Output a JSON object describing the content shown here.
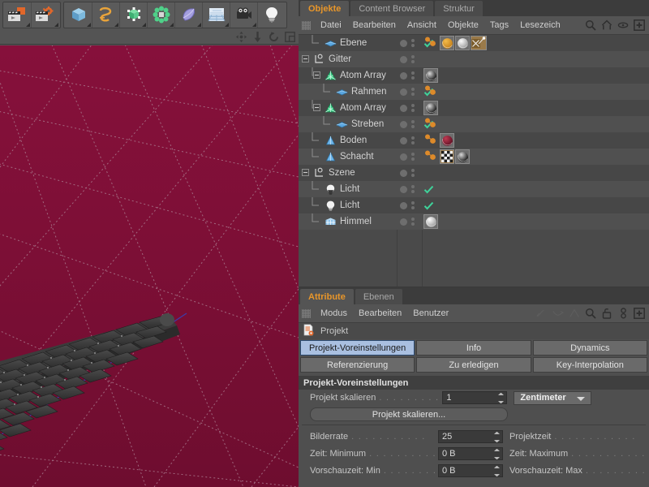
{
  "toolbar": {
    "groups": [
      {
        "name": "playback-group",
        "buttons": [
          {
            "name": "render-view-button",
            "icon": "clapper-render-icon"
          },
          {
            "name": "render-settings-button",
            "icon": "clapper-gear-icon"
          }
        ]
      },
      {
        "name": "primitives-group",
        "buttons": [
          {
            "name": "cube-button",
            "icon": "cube-icon"
          },
          {
            "name": "spline-button",
            "icon": "spline-pen-icon"
          },
          {
            "name": "nurbs-button",
            "icon": "green-cube-icon"
          },
          {
            "name": "array-button",
            "icon": "cluster-icon"
          },
          {
            "name": "deformer-button",
            "icon": "bend-blob-icon"
          },
          {
            "name": "scene-button",
            "icon": "floor-grid-icon"
          },
          {
            "name": "camera-button",
            "icon": "camera-icon"
          },
          {
            "name": "light-button",
            "icon": "lightbulb-icon"
          }
        ]
      }
    ]
  },
  "viewport": {
    "nav_icons": [
      {
        "name": "move-camera-icon",
        "glyph": "move"
      },
      {
        "name": "dolly-camera-icon",
        "glyph": "dolly"
      },
      {
        "name": "rotate-camera-icon",
        "glyph": "rotate"
      },
      {
        "name": "maximize-view-icon",
        "glyph": "maximize"
      }
    ],
    "background_color": "#7d0f36",
    "grid_color": "#9d6b80",
    "axis_color": "#3a3fb0"
  },
  "object_manager": {
    "tabs": [
      {
        "label": "Objekte",
        "active": true
      },
      {
        "label": "Content Browser",
        "active": false
      },
      {
        "label": "Struktur",
        "active": false
      }
    ],
    "menu": [
      "Datei",
      "Bearbeiten",
      "Ansicht",
      "Objekte",
      "Tags",
      "Lesezeich"
    ],
    "menu_icons": [
      {
        "name": "search-icon"
      },
      {
        "name": "home-icon"
      },
      {
        "name": "eye-icon"
      },
      {
        "name": "add-box-icon"
      }
    ],
    "rows": [
      {
        "name": "Ebene",
        "icon": "polygon-plane-icon",
        "indent": 1,
        "expander": false,
        "check": true,
        "tags": [
          "material-dots",
          "material-gold",
          "material-white",
          "texture-axis"
        ]
      },
      {
        "name": "Gitter",
        "icon": "null-object-icon",
        "indent": 0,
        "expander": true,
        "check": false,
        "tags": []
      },
      {
        "name": "Atom Array",
        "icon": "atom-array-icon",
        "indent": 1,
        "expander": true,
        "check": true,
        "tags": [
          "material-black"
        ]
      },
      {
        "name": "Rahmen",
        "icon": "polygon-plane-icon",
        "indent": 2,
        "expander": false,
        "check": true,
        "tags": [
          "material-dots"
        ]
      },
      {
        "name": "Atom Array",
        "icon": "atom-array-icon",
        "indent": 1,
        "expander": true,
        "check": true,
        "tags": [
          "material-black"
        ]
      },
      {
        "name": "Streben",
        "icon": "polygon-plane-icon",
        "indent": 2,
        "expander": false,
        "check": true,
        "tags": [
          "material-dots"
        ]
      },
      {
        "name": "Boden",
        "icon": "cone-icon",
        "indent": 1,
        "expander": false,
        "check": false,
        "tags": [
          "material-dots",
          "material-red"
        ]
      },
      {
        "name": "Schacht",
        "icon": "cone-icon",
        "indent": 1,
        "expander": false,
        "check": false,
        "tags": [
          "material-dots",
          "texture-checker",
          "material-black"
        ]
      },
      {
        "name": "Szene",
        "icon": "null-object-icon",
        "indent": 0,
        "expander": true,
        "check": false,
        "tags": []
      },
      {
        "name": "Licht",
        "icon": "light-dark-icon",
        "indent": 1,
        "expander": false,
        "check": true,
        "tags": []
      },
      {
        "name": "Licht",
        "icon": "light-icon",
        "indent": 1,
        "expander": false,
        "check": true,
        "tags": []
      },
      {
        "name": "Himmel",
        "icon": "sky-icon",
        "indent": 1,
        "expander": false,
        "check": false,
        "tags": [
          "material-white"
        ]
      }
    ]
  },
  "attribute_manager": {
    "tabs": [
      {
        "label": "Attribute",
        "active": true
      },
      {
        "label": "Ebenen",
        "active": false
      }
    ],
    "menu": [
      "Modus",
      "Bearbeiten",
      "Benutzer"
    ],
    "menu_icons": [
      {
        "name": "curve-icon"
      },
      {
        "name": "curve-arrow-icon"
      },
      {
        "name": "curve-peak-icon"
      },
      {
        "name": "search-icon"
      },
      {
        "name": "unlock-icon"
      },
      {
        "name": "pin-icon"
      },
      {
        "name": "add-box-icon"
      }
    ],
    "object_title": "Projekt",
    "object_icon": "project-doc-icon",
    "mode_tabs": [
      {
        "label": "Projekt-Voreinstellungen",
        "selected": true
      },
      {
        "label": "Info",
        "selected": false
      },
      {
        "label": "Dynamics",
        "selected": false
      },
      {
        "label": "Referenzierung",
        "selected": false
      },
      {
        "label": "Zu erledigen",
        "selected": false
      },
      {
        "label": "Key-Interpolation",
        "selected": false
      }
    ],
    "group_header": "Projekt-Voreinstellungen",
    "scale_row": {
      "label": "Projekt skalieren",
      "value": "1",
      "unit": "Zentimeter",
      "button": "Projekt skalieren..."
    },
    "fields": [
      {
        "label": "Bilderrate",
        "value": "25",
        "label2": "Projektzeit",
        "value2": ""
      },
      {
        "label": "Zeit: Minimum",
        "value": "0 B",
        "label2": "Zeit: Maximum",
        "value2": ""
      },
      {
        "label": "Vorschauzeit: Min",
        "value": "0 B",
        "label2": "Vorschauzeit: Max",
        "value2": ""
      }
    ]
  },
  "colors": {
    "accent": "#e8962a",
    "tab_selected": "#a9bfe0",
    "check": "#3fd29a",
    "panel_bg": "#4f4f4f"
  }
}
